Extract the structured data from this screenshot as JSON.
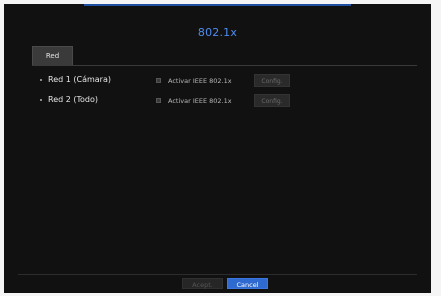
{
  "dialog": {
    "title": "802.1x"
  },
  "tabs": [
    {
      "label": "Red",
      "active": true
    }
  ],
  "rows": [
    {
      "label": "Red 1 (Cámara)",
      "checkbox_label": "Activar IEEE 802.1x",
      "checked": false,
      "config_label": "Config."
    },
    {
      "label": "Red 2 (Todo)",
      "checkbox_label": "Activar IEEE 802.1x",
      "checked": false,
      "config_label": "Config."
    }
  ],
  "footer": {
    "accept_label": "Acept.",
    "cancel_label": "Cancel"
  },
  "colors": {
    "background": "#111111",
    "title": "#4e8cf0",
    "primary_button": "#2f6ad0"
  }
}
